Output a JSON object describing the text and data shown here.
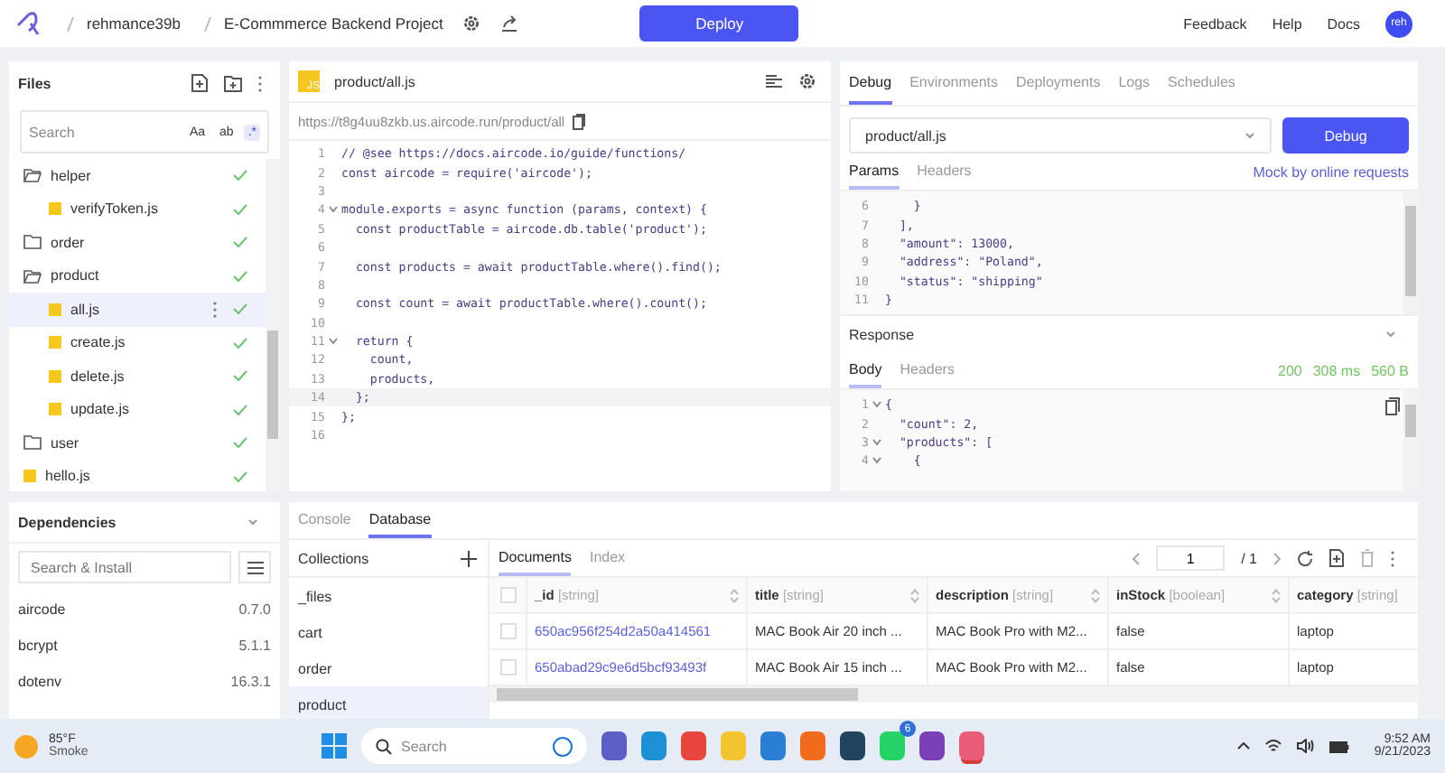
{
  "topbar": {
    "breadcrumb": [
      "rehmance39b",
      "E-Commmerce Backend Project"
    ],
    "deploy": "Deploy",
    "links": [
      "Feedback",
      "Help",
      "Docs"
    ],
    "avatar": "reh"
  },
  "files": {
    "title": "Files",
    "search": {
      "placeholder": "Search"
    },
    "search_options": [
      {
        "label": "Aa",
        "selected": false
      },
      {
        "label": "ab",
        "selected": false
      },
      {
        "label": ".*",
        "selected": true
      }
    ],
    "tree": [
      {
        "name": "helper",
        "kind": "folder",
        "expanded": true,
        "synced": true,
        "selected": false,
        "children": [
          {
            "name": "verifyToken.js",
            "kind": "file",
            "synced": true,
            "selected": false
          }
        ]
      },
      {
        "name": "order",
        "kind": "folder",
        "expanded": false,
        "synced": true,
        "selected": false
      },
      {
        "name": "product",
        "kind": "folder",
        "expanded": true,
        "synced": true,
        "selected": false,
        "children": [
          {
            "name": "all.js",
            "kind": "file",
            "synced": true,
            "selected": true
          },
          {
            "name": "create.js",
            "kind": "file",
            "synced": true,
            "selected": false
          },
          {
            "name": "delete.js",
            "kind": "file",
            "synced": true,
            "selected": false
          },
          {
            "name": "update.js",
            "kind": "file",
            "synced": true,
            "selected": false
          }
        ]
      },
      {
        "name": "user",
        "kind": "folder",
        "expanded": false,
        "synced": true,
        "selected": false
      },
      {
        "name": "hello.js",
        "kind": "file",
        "synced": true,
        "selected": false
      }
    ]
  },
  "editor": {
    "filename": "product/all.js",
    "badge": "JS",
    "url": "https://t8g4uu8zkb.us.aircode.run/product/all",
    "lines": [
      {
        "n": "1",
        "code": "// @see https://docs.aircode.io/guide/functions/",
        "fold": false,
        "current": false
      },
      {
        "n": "2",
        "code": "const aircode = require('aircode');",
        "fold": false,
        "current": false
      },
      {
        "n": "3",
        "fold": false,
        "current": false
      },
      {
        "n": "4",
        "code": "module.exports = async function (params, context) {",
        "fold": true,
        "current": false
      },
      {
        "n": "5",
        "code": "  const productTable = aircode.db.table('product');",
        "fold": false,
        "current": false
      },
      {
        "n": "6",
        "fold": false,
        "current": false
      },
      {
        "n": "7",
        "code": "  const products = await productTable.where().find();",
        "fold": false,
        "current": false
      },
      {
        "n": "8",
        "fold": false,
        "current": false
      },
      {
        "n": "9",
        "code": "  const count = await productTable.where().count();",
        "fold": false,
        "current": false
      },
      {
        "n": "10",
        "fold": false,
        "current": false
      },
      {
        "n": "11",
        "code": "  return {",
        "fold": true,
        "current": false
      },
      {
        "n": "12",
        "code": "    count,",
        "fold": false,
        "current": false
      },
      {
        "n": "13",
        "code": "    products,",
        "fold": false,
        "current": false
      },
      {
        "n": "14",
        "code": "  };",
        "fold": false,
        "current": true
      },
      {
        "n": "15",
        "code": "};",
        "fold": false,
        "current": false
      },
      {
        "n": "16",
        "fold": false,
        "current": false
      }
    ]
  },
  "debug": {
    "tabs": [
      {
        "label": "Debug",
        "selected": true
      },
      {
        "label": "Environments",
        "selected": false
      },
      {
        "label": "Deployments",
        "selected": false
      },
      {
        "label": "Logs",
        "selected": false
      },
      {
        "label": "Schedules",
        "selected": false
      }
    ],
    "function_select": "product/all.js",
    "debug_button": "Debug",
    "params_tabs": [
      {
        "label": "Params",
        "selected": true
      },
      {
        "label": "Headers",
        "selected": false
      }
    ],
    "mock_link": "Mock by online requests",
    "params_lines": [
      {
        "n": "6",
        "code": "    }",
        "fold": false
      },
      {
        "n": "7",
        "code": "  ],",
        "fold": false
      },
      {
        "n": "8",
        "code": "  \"amount\": 13000,",
        "fold": false
      },
      {
        "n": "9",
        "code": "  \"address\": \"Poland\",",
        "fold": false
      },
      {
        "n": "10",
        "code": "  \"status\": \"shipping\"",
        "fold": false
      },
      {
        "n": "11",
        "code": "}",
        "fold": false
      }
    ],
    "response_title": "Response",
    "body_tabs": [
      {
        "label": "Body",
        "selected": true
      },
      {
        "label": "Headers",
        "selected": false
      }
    ],
    "status": [
      "200",
      "308 ms",
      "560 B"
    ],
    "response_lines": [
      {
        "n": "1",
        "code": "{",
        "fold": true
      },
      {
        "n": "2",
        "code": "  \"count\": 2,",
        "fold": false
      },
      {
        "n": "3",
        "code": "  \"products\": [",
        "fold": true
      },
      {
        "n": "4",
        "code": "    {",
        "fold": true
      }
    ]
  },
  "dependencies": {
    "title": "Dependencies",
    "search": {
      "placeholder": "Search & Install"
    },
    "items": [
      {
        "name": "aircode",
        "version": "0.7.0"
      },
      {
        "name": "bcrypt",
        "version": "5.1.1"
      },
      {
        "name": "dotenv",
        "version": "16.3.1"
      }
    ]
  },
  "bottom": {
    "tabs": [
      {
        "label": "Console",
        "selected": false
      },
      {
        "label": "Database",
        "selected": true
      }
    ],
    "collections_title": "Collections",
    "collections": [
      {
        "name": "_files",
        "selected": false
      },
      {
        "name": "cart",
        "selected": false
      },
      {
        "name": "order",
        "selected": false
      },
      {
        "name": "product",
        "selected": true
      }
    ],
    "doc_tabs": [
      {
        "label": "Documents",
        "selected": true
      },
      {
        "label": "Index",
        "selected": false
      }
    ],
    "pagination": {
      "page": "1",
      "total": "/ 1"
    },
    "table": {
      "select_all_checked": false,
      "columns": [
        {
          "name": "_id",
          "type": "[string]"
        },
        {
          "name": "title",
          "type": "[string]"
        },
        {
          "name": "description",
          "type": "[string]"
        },
        {
          "name": "inStock",
          "type": "[boolean]"
        },
        {
          "name": "category",
          "type": "[string]"
        }
      ],
      "rows": [
        {
          "checked": false,
          "cells": [
            "650ac956f254d2a50a414561",
            "MAC Book Air 20 inch ...",
            "MAC Book Pro with M2...",
            "false",
            "laptop"
          ]
        },
        {
          "checked": false,
          "cells": [
            "650abad29c9e6d5bcf93493f",
            "MAC Book Air 15 inch ...",
            "MAC Book Pro with M2...",
            "false",
            "laptop"
          ]
        }
      ]
    }
  },
  "taskbar": {
    "weather": {
      "temp": "85°F",
      "condition": "Smoke"
    },
    "search": {
      "placeholder": "Search"
    },
    "apps": [
      {
        "active": false
      },
      {
        "active": false
      },
      {
        "active": false
      },
      {
        "active": false
      },
      {
        "active": false
      },
      {
        "active": false
      },
      {
        "active": false
      },
      {
        "active": false,
        "badge": "6"
      },
      {
        "active": false
      },
      {
        "active": true
      }
    ],
    "time": "9:52 AM",
    "date": "9/21/2023"
  }
}
